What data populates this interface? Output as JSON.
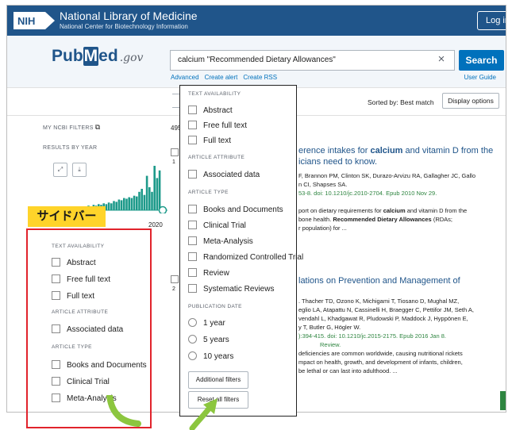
{
  "header": {
    "logo_text": "NIH",
    "title": "National Library of Medicine",
    "subtitle": "National Center for Biotechnology Information",
    "login": "Log in"
  },
  "search": {
    "logo_pub": "Pub",
    "logo_m": "M",
    "logo_ed": "ed",
    "logo_gov": ".gov",
    "query": "calcium \"Recommended Dietary Allowances\"",
    "clear_icon": "×",
    "button": "Search",
    "links": [
      "Advanced",
      "Create alert",
      "Create RSS"
    ],
    "user_guide": "User Guide"
  },
  "toolbar": {
    "sort_label": "Sorted by: Best match",
    "display_options": "Display options",
    "count_stub": "495"
  },
  "sidebar": {
    "my_ncbi_filters": "MY NCBI FILTERS",
    "ext_icon": "⧉",
    "results_by_year": "RESULTS BY YEAR",
    "expand_icon": "⤢",
    "download_icon": "⤓",
    "year_label": "2020",
    "badge": "サイドバー",
    "text_availability": "TEXT AVAILABILITY",
    "text_items": [
      "Abstract",
      "Free full text",
      "Full text"
    ],
    "article_attribute": "ARTICLE ATTRIBUTE",
    "attr_items": [
      "Associated data"
    ],
    "article_type": "ARTICLE TYPE",
    "type_items": [
      "Books and Documents",
      "Clinical Trial",
      "Meta-Analysis"
    ]
  },
  "panel": {
    "text_availability": "TEXT AVAILABILITY",
    "text_items": [
      "Abstract",
      "Free full text",
      "Full text"
    ],
    "article_attribute": "ARTICLE ATTRIBUTE",
    "attr_items": [
      "Associated data"
    ],
    "article_type": "ARTICLE TYPE",
    "type_items": [
      "Books and Documents",
      "Clinical Trial",
      "Meta-Analysis",
      "Randomized Controlled Trial",
      "Review",
      "Systematic Reviews"
    ],
    "publication_date": "PUBLICATION DATE",
    "date_items": [
      "1 year",
      "5 years",
      "10 years"
    ],
    "additional_filters": "Additional filters",
    "reset_filters": "Reset all filters"
  },
  "results": [
    {
      "num": "1",
      "title_pre": "erence intakes for ",
      "title_bold": "calcium",
      "title_post": " and vitamin D from the",
      "title_line2": "icians need to know.",
      "authors1": "F, Brannon PM, Clinton SK, Durazo-Arvizu RA, Gallagher JC, Gallo",
      "authors2": "n CI, Shapses SA.",
      "citation": "53-8. doi: 10.1210/jc.2010-2704. Epub 2010 Nov 29.",
      "snip1_pre": "port on dietary requirements for ",
      "snip1_bold": "calcium",
      "snip1_post": " and vitamin D from the",
      "snip2_pre": "bone health. ",
      "snip2_bold": "Recommended Dietary Allowances",
      "snip2_post": " (RDAs;",
      "snip3": "r population) for ..."
    },
    {
      "num": "2",
      "title": "lations on Prevention and Management of",
      "authors1": ". Thacher TD, Ozono K, Michigami T, Tiosano D, Mughal MZ,",
      "authors2": "eglio LA, Atapattu N, Cassinelli H, Braegger C, Pettifor JM, Seth A,",
      "authors3": "vendahl L, Khadgawat R, Pludowski P, Maddock J, Hyppönen E,",
      "authors4": "y T, Butler G, Högler W.",
      "citation": "):394-415. doi: 10.1210/jc.2015-2175. Epub 2016 Jan 8.",
      "review": "Review.",
      "snip1": "deficiencies are common worldwide, causing nutritional rickets",
      "snip2": "mpact on health, growth, and development of infants, children,",
      "snip3": "be lethal or can last into adulthood. ..."
    }
  ],
  "histogram_values": [
    3,
    2,
    3,
    2,
    4,
    3,
    2,
    4,
    3,
    5,
    4,
    6,
    5,
    7,
    6,
    8,
    7,
    9,
    8,
    10,
    9,
    12,
    11,
    14,
    13,
    16,
    15,
    17,
    16,
    19,
    18,
    24,
    28,
    20,
    45,
    30,
    24,
    58,
    42,
    52
  ],
  "colors": {
    "nih_blue": "#20558a",
    "search_blue": "#0071bc",
    "highlight_yellow": "#ffd42a",
    "frame_red": "#e1232c",
    "arrow_green": "#8cc63f"
  }
}
